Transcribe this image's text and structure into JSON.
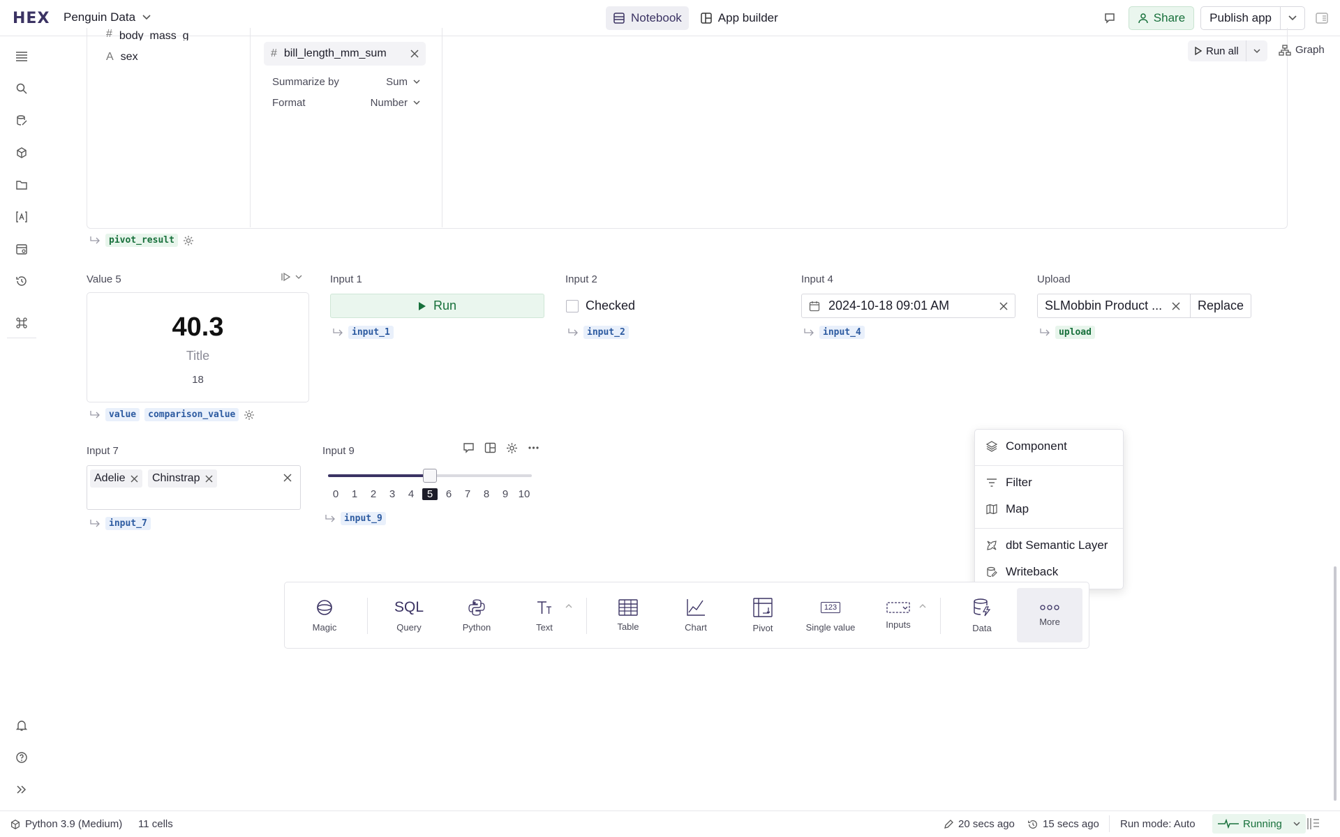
{
  "app": {
    "logo": "HEX",
    "project_title": "Penguin Data"
  },
  "mode_tabs": [
    {
      "label": "Notebook",
      "icon": "notebook-icon",
      "active": true
    },
    {
      "label": "App builder",
      "icon": "app-builder-icon",
      "active": false
    }
  ],
  "header_actions": {
    "share": "Share",
    "publish": "Publish app"
  },
  "pivot": {
    "fields": [
      {
        "type": "#",
        "name": "body_mass_g"
      },
      {
        "type": "A",
        "name": "sex"
      }
    ],
    "value_chip": "bill_length_mm_sum",
    "options": [
      {
        "label": "Summarize by",
        "value": "Sum"
      },
      {
        "label": "Format",
        "value": "Number"
      }
    ],
    "result_var": "pivot_result",
    "run_all": "Run all",
    "graph": "Graph"
  },
  "cells": {
    "value5": {
      "label": "Value 5",
      "number": "40.3",
      "title": "Title",
      "comparison": "18",
      "vars": [
        "value",
        "comparison_value"
      ]
    },
    "input1": {
      "label": "Input 1",
      "button": "Run",
      "var": "input_1"
    },
    "input2": {
      "label": "Input 2",
      "checkbox_label": "Checked",
      "checked": false,
      "var": "input_2"
    },
    "input4": {
      "label": "Input 4",
      "value": "2024-10-18 09:01 AM",
      "var": "input_4"
    },
    "upload": {
      "label": "Upload",
      "filename": "SLMobbin Product ...",
      "replace": "Replace",
      "var": "upload"
    },
    "input7": {
      "label": "Input 7",
      "chips": [
        "Adelie",
        "Chinstrap"
      ],
      "var": "input_7"
    },
    "input9": {
      "label": "Input 9",
      "ticks": [
        "0",
        "1",
        "2",
        "3",
        "4",
        "5",
        "6",
        "7",
        "8",
        "9",
        "10"
      ],
      "min": 0,
      "max": 10,
      "value": 5,
      "var": "input_9"
    }
  },
  "toolbar": [
    {
      "label": "Magic",
      "icon": "magic-icon"
    },
    {
      "label": "Query",
      "icon": "sql-icon",
      "glyph": "SQL"
    },
    {
      "label": "Python",
      "icon": "python-icon"
    },
    {
      "label": "Text",
      "icon": "text-icon"
    },
    {
      "label": "Table",
      "icon": "table-icon"
    },
    {
      "label": "Chart",
      "icon": "chart-icon"
    },
    {
      "label": "Pivot",
      "icon": "pivot-icon"
    },
    {
      "label": "Single value",
      "icon": "single-value-icon",
      "glyph": "123"
    },
    {
      "label": "Inputs",
      "icon": "inputs-icon"
    },
    {
      "label": "Data",
      "icon": "data-icon"
    },
    {
      "label": "More",
      "icon": "more-icon",
      "active": true
    }
  ],
  "more_menu": [
    {
      "label": "Component",
      "icon": "layers-icon"
    },
    {
      "label": "Filter",
      "icon": "filter-icon"
    },
    {
      "label": "Map",
      "icon": "map-icon"
    },
    {
      "label": "dbt Semantic Layer",
      "icon": "dbt-icon"
    },
    {
      "label": "Writeback",
      "icon": "writeback-icon"
    }
  ],
  "status_bar": {
    "kernel": "Python 3.9 (Medium)",
    "cells": "11 cells",
    "edited": "20 secs ago",
    "saved": "15 secs ago",
    "run_mode": "Run mode: Auto",
    "status": "Running"
  },
  "colors": {
    "brand": "#3b3363",
    "success": "#17703b",
    "success_bg": "#eaf6ee",
    "tag_blue": "#2c5aa0"
  }
}
